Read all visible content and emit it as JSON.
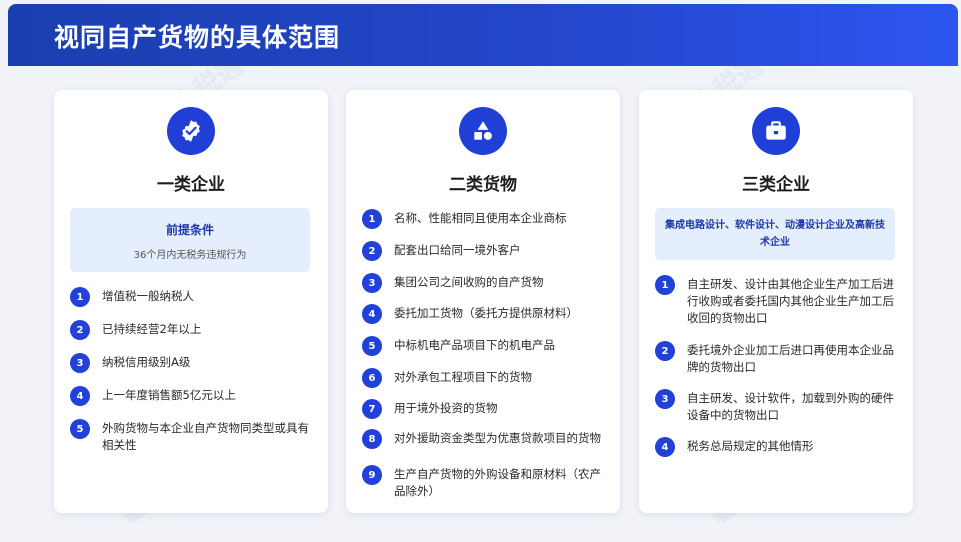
{
  "header": {
    "title": "视同自产货物的具体范围"
  },
  "watermark": "馨天全税通",
  "cards": [
    {
      "title": "一类企业",
      "icon": "badge-check-icon",
      "condition": {
        "title": "前提条件",
        "subtitle": "36个月内无税务违规行为"
      },
      "items": [
        {
          "num": "1",
          "text": "增值税一般纳税人"
        },
        {
          "num": "2",
          "text": "已持续经营2年以上"
        },
        {
          "num": "3",
          "text": "纳税信用级别A级"
        },
        {
          "num": "4",
          "text": "上一年度销售额5亿元以上"
        },
        {
          "num": "5",
          "text": "外购货物与本企业自产货物同类型或具有相关性"
        }
      ]
    },
    {
      "title": "二类货物",
      "icon": "shapes-icon",
      "items": [
        {
          "num": "1",
          "text": "名称、性能相同且使用本企业商标"
        },
        {
          "num": "2",
          "text": "配套出口给同一境外客户"
        },
        {
          "num": "3",
          "text": "集团公司之间收购的自产货物"
        },
        {
          "num": "4",
          "text": "委托加工货物（委托方提供原材料）"
        },
        {
          "num": "5",
          "text": "中标机电产品项目下的机电产品"
        },
        {
          "num": "6",
          "text": "对外承包工程项目下的货物"
        },
        {
          "num": "7",
          "text": "用于境外投资的货物"
        },
        {
          "num": "8",
          "text": "对外援助资金类型为优惠贷款项目的货物"
        },
        {
          "num": "9",
          "text": "生产自产货物的外购设备和原材料（农产品除外）"
        }
      ]
    },
    {
      "title": "三类企业",
      "icon": "briefcase-icon",
      "tech": "集成电路设计、软件设计、动漫设计企业及高新技术企业",
      "items": [
        {
          "num": "1",
          "text": "自主研发、设计由其他企业生产加工后进行收购或者委托国内其他企业生产加工后收回的货物出口"
        },
        {
          "num": "2",
          "text": "委托境外企业加工后进口再使用本企业品牌的货物出口"
        },
        {
          "num": "3",
          "text": "自主研发、设计软件，加载到外购的硬件设备中的货物出口"
        },
        {
          "num": "4",
          "text": "税务总局规定的其他情形"
        }
      ]
    }
  ]
}
